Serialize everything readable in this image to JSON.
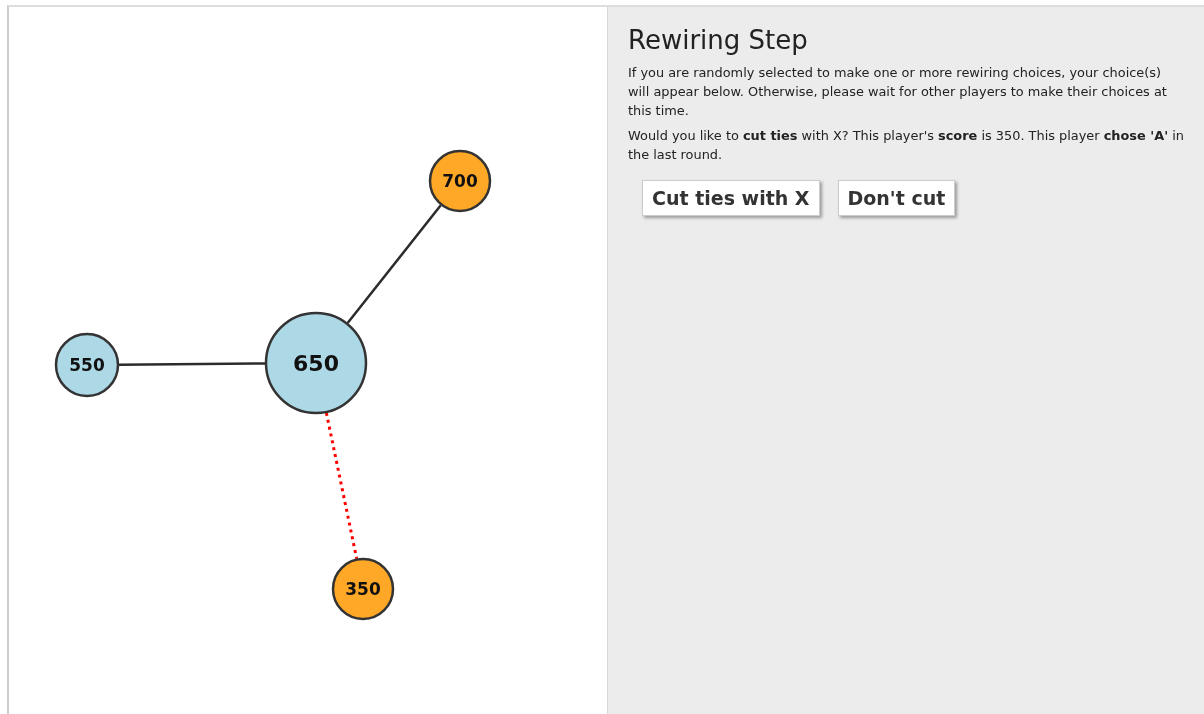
{
  "graph": {
    "center": {
      "label": "650",
      "color": "#add8e6"
    },
    "neighbors": [
      {
        "label": "550",
        "color": "#add8e6",
        "highlighted": false
      },
      {
        "label": "700",
        "color": "#ffa726",
        "highlighted": false
      },
      {
        "label": "350",
        "color": "#ffa726",
        "highlighted": true
      }
    ]
  },
  "panel": {
    "title": "Rewiring Step",
    "paragraphs": [
      "If you are randomly selected to make one or more rewiring choices, your choice(s) will appear below. Otherwise, please wait for other players to make their choices at this time.",
      "Would you like to **cut ties** with X? This player's **score** is 350. This player **chose 'A'** in the last round."
    ],
    "buttons": [
      "Cut ties with X",
      "Don't cut"
    ]
  }
}
